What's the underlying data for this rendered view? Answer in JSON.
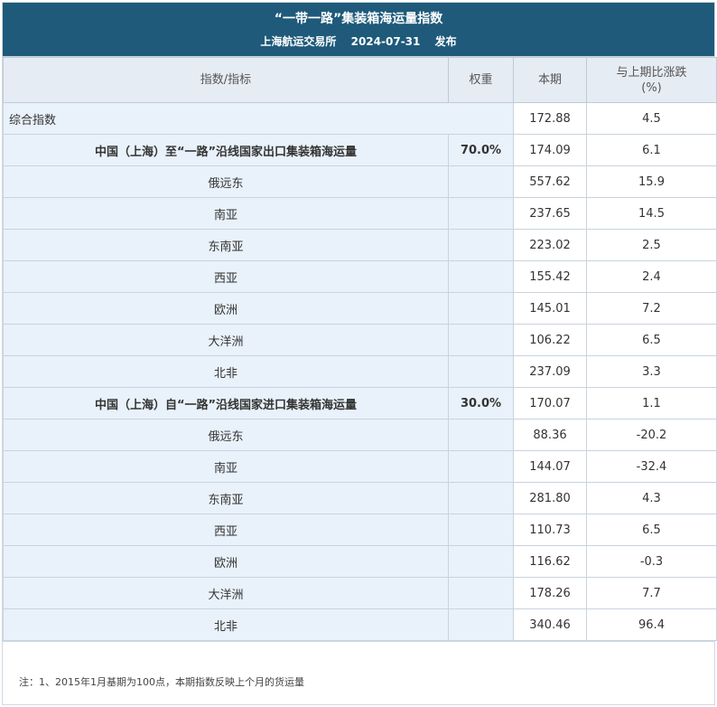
{
  "banner": {
    "title": "“一带一路”集装箱海运量指数",
    "publisher": "上海航运交易所",
    "date": "2024-07-31",
    "publish_label": "发布"
  },
  "table": {
    "headers": {
      "name": "指数/指标",
      "weight": "权重",
      "current": "本期",
      "change_line1": "与上期比涨跌",
      "change_line2": "(%)"
    },
    "composite": {
      "name": "综合指数",
      "value": "172.88",
      "change": "4.5"
    },
    "export_group": {
      "name": "中国（上海）至“一路”沿线国家出口集装箱海运量",
      "weight": "70.0%",
      "value": "174.09",
      "change": "6.1",
      "regions": [
        {
          "name": "俄远东",
          "value": "557.62",
          "change": "15.9"
        },
        {
          "name": "南亚",
          "value": "237.65",
          "change": "14.5"
        },
        {
          "name": "东南亚",
          "value": "223.02",
          "change": "2.5"
        },
        {
          "name": "西亚",
          "value": "155.42",
          "change": "2.4"
        },
        {
          "name": "欧洲",
          "value": "145.01",
          "change": "7.2"
        },
        {
          "name": "大洋洲",
          "value": "106.22",
          "change": "6.5"
        },
        {
          "name": "北非",
          "value": "237.09",
          "change": "3.3"
        }
      ]
    },
    "import_group": {
      "name": "中国（上海）自“一路”沿线国家进口集装箱海运量",
      "weight": "30.0%",
      "value": "170.07",
      "change": "1.1",
      "regions": [
        {
          "name": "俄远东",
          "value": "88.36",
          "change": "-20.2"
        },
        {
          "name": "南亚",
          "value": "144.07",
          "change": "-32.4"
        },
        {
          "name": "东南亚",
          "value": "281.80",
          "change": "4.3"
        },
        {
          "name": "西亚",
          "value": "110.73",
          "change": "6.5"
        },
        {
          "name": "欧洲",
          "value": "116.62",
          "change": "-0.3"
        },
        {
          "name": "大洋洲",
          "value": "178.26",
          "change": "7.7"
        },
        {
          "name": "北非",
          "value": "340.46",
          "change": "96.4"
        }
      ]
    }
  },
  "note": "注：1、2015年1月基期为100点，本期指数反映上个月的货运量"
}
